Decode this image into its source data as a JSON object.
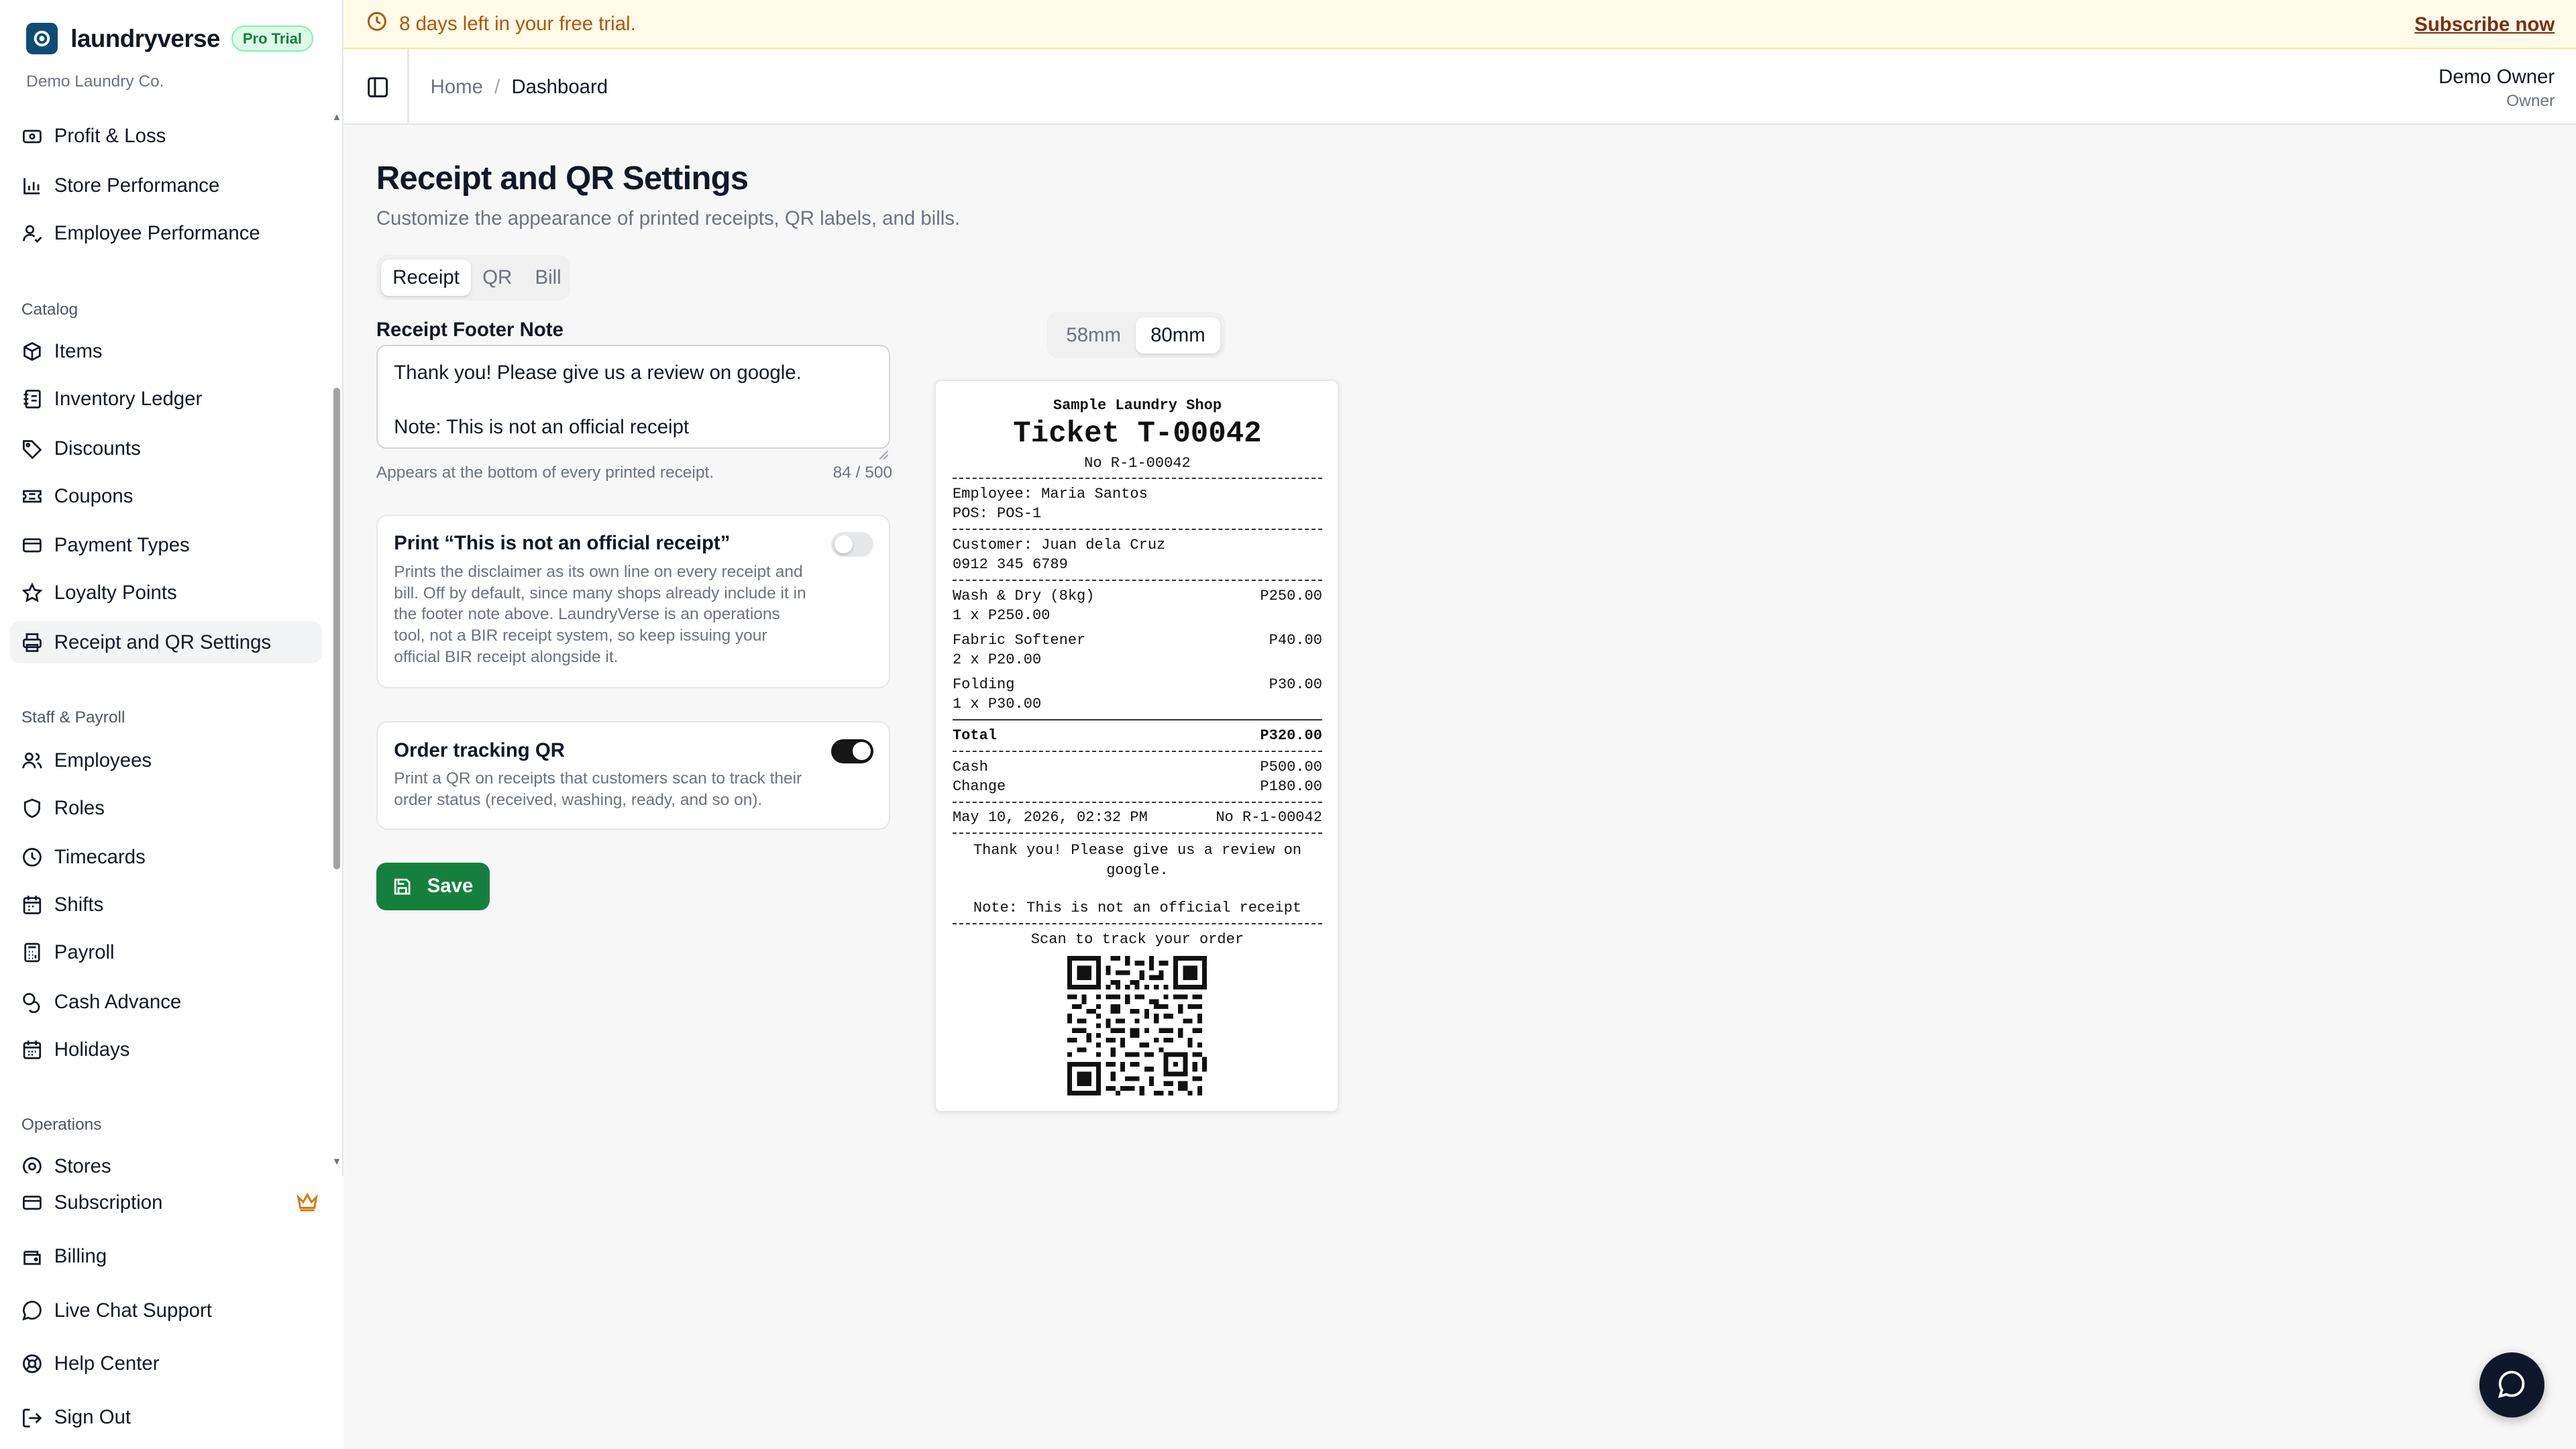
{
  "brand": {
    "name": "laundryverse",
    "badge": "Pro Trial",
    "company": "Demo Laundry Co."
  },
  "trial": {
    "message": "8 days left in your free trial.",
    "cta": "Subscribe now"
  },
  "header": {
    "breadcrumb_home": "Home",
    "breadcrumb_sep": "/",
    "breadcrumb_current": "Dashboard",
    "user_name": "Demo Owner",
    "user_role": "Owner"
  },
  "sidebar": {
    "reports": [
      {
        "label": "Profit & Loss",
        "icon": "wallet-icon"
      },
      {
        "label": "Store Performance",
        "icon": "bar-chart-icon"
      },
      {
        "label": "Employee Performance",
        "icon": "user-check-icon"
      }
    ],
    "catalog_title": "Catalog",
    "catalog": [
      {
        "label": "Items",
        "icon": "package-icon"
      },
      {
        "label": "Inventory Ledger",
        "icon": "ledger-icon"
      },
      {
        "label": "Discounts",
        "icon": "tag-icon"
      },
      {
        "label": "Coupons",
        "icon": "ticket-icon"
      },
      {
        "label": "Payment Types",
        "icon": "credit-card-icon"
      },
      {
        "label": "Loyalty Points",
        "icon": "star-icon"
      },
      {
        "label": "Receipt and QR Settings",
        "icon": "printer-icon"
      }
    ],
    "staff_title": "Staff & Payroll",
    "staff": [
      {
        "label": "Employees",
        "icon": "users-icon"
      },
      {
        "label": "Roles",
        "icon": "shield-icon"
      },
      {
        "label": "Timecards",
        "icon": "clock-icon"
      },
      {
        "label": "Shifts",
        "icon": "calendar-icon"
      },
      {
        "label": "Payroll",
        "icon": "calculator-icon"
      },
      {
        "label": "Cash Advance",
        "icon": "coins-icon"
      },
      {
        "label": "Holidays",
        "icon": "calendar-days-icon"
      }
    ],
    "operations_title": "Operations",
    "operations": [
      {
        "label": "Stores",
        "icon": "store-icon"
      }
    ],
    "footer": [
      {
        "label": "Subscription",
        "icon": "credit-card-icon"
      },
      {
        "label": "Billing",
        "icon": "wallet-icon"
      },
      {
        "label": "Live Chat Support",
        "icon": "message-circle-icon"
      },
      {
        "label": "Help Center",
        "icon": "help-circle-icon"
      },
      {
        "label": "Sign Out",
        "icon": "log-out-icon"
      }
    ]
  },
  "page": {
    "title": "Receipt and QR Settings",
    "subtitle": "Customize the appearance of printed receipts, QR labels, and bills.",
    "tabs": [
      "Receipt",
      "QR",
      "Bill"
    ],
    "footer_label": "Receipt Footer Note",
    "footer_value": "Thank you! Please give us a review on google.\n\nNote: This is not an official receipt",
    "footer_help": "Appears at the bottom of every printed receipt.",
    "footer_counter": "84 / 500",
    "disclaimer_title": "Print “This is not an official receipt”",
    "disclaimer_desc": "Prints the disclaimer as its own line on every receipt and bill. Off by default, since many shops already include it in the footer note above. LaundryVerse is an operations tool, not a BIR receipt system, so keep issuing your official BIR receipt alongside it.",
    "disclaimer_enabled": false,
    "tracking_title": "Order tracking QR",
    "tracking_desc": "Print a QR on receipts that customers scan to track their order status (received, washing, ready, and so on).",
    "tracking_enabled": true,
    "save_label": "Save",
    "sizes": [
      "58mm",
      "80mm"
    ],
    "selected_size": "80mm"
  },
  "receipt": {
    "shop": "Sample Laundry Shop",
    "ticket": "Ticket T-00042",
    "no": "No R-1-00042",
    "employee": "Employee: Maria Santos",
    "pos": "POS: POS-1",
    "customer": "Customer: Juan dela Cruz",
    "phone": "0912 345 6789",
    "items": [
      {
        "name": "Wash & Dry (8kg)",
        "price": "P250.00",
        "qty": "1 x P250.00"
      },
      {
        "name": "Fabric Softener",
        "price": "P40.00",
        "qty": "2 x P20.00"
      },
      {
        "name": "Folding",
        "price": "P30.00",
        "qty": "1 x P30.00"
      }
    ],
    "total_label": "Total",
    "total": "P320.00",
    "cash_label": "Cash",
    "cash": "P500.00",
    "change_label": "Change",
    "change": "P180.00",
    "date": "May 10, 2026, 02:32 PM",
    "date_no": "No R-1-00042",
    "footer_line1": "Thank you! Please give us a review on",
    "footer_line2": "google.",
    "footer_note": "Note: This is not an official receipt",
    "scan_text": "Scan to track your order"
  },
  "colors": {
    "accent": "#15803d",
    "trial_bg": "#fefce8",
    "trial_text": "#b45309",
    "brand_logo": "#0f4c75"
  }
}
